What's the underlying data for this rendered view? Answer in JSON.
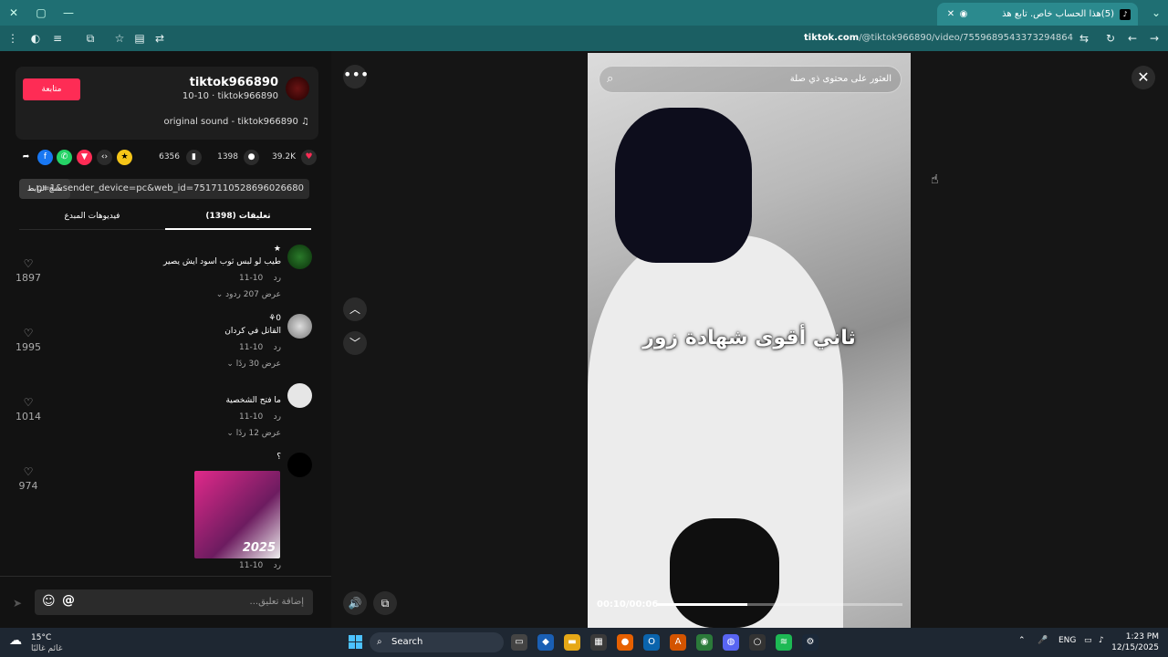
{
  "browser": {
    "tab_title": "(5)هذا الحساب خاص. تابع هذ",
    "tab_favicon": "tiktok-icon",
    "url_host": "tiktok.com",
    "url_path": "/@tiktok966890/video/7559689543373294864"
  },
  "author": {
    "username": "tiktok966890",
    "subline": "10-10 · tiktok966890",
    "follow_label": "متابعة",
    "sound": "original sound - tiktok966890"
  },
  "actions": {
    "likes": "39.2K",
    "comments": "1398",
    "saves": "6356"
  },
  "link": {
    "copy_label": "نسخ الرابط",
    "text": "...p=1&sender_device=pc&web_id=7517110528696026680"
  },
  "tabs": {
    "comments_label": "(1398) تعليقات",
    "creator_videos_label": "فيديوهات المبدع"
  },
  "comments": [
    {
      "name": "★",
      "text": "طيب لو لبس ثوب اسود ايش يصير",
      "date": "10-11",
      "reply": "رد",
      "view_replies": "عرض 207 ردود",
      "likes": "1897"
    },
    {
      "name": "⚘0",
      "text": "القاتل في كردان",
      "date": "10-11",
      "reply": "رد",
      "view_replies": "عرض 30 ردًا",
      "likes": "1995"
    },
    {
      "name": "",
      "text": "ما فتح الشخصية",
      "date": "10-11",
      "reply": "رد",
      "view_replies": "عرض 12 ردًا",
      "likes": "1014"
    },
    {
      "name": "؟",
      "text": "",
      "date": "10-11",
      "reply": "رد",
      "view_replies": "",
      "likes": "974",
      "sticker_label": "2025"
    }
  ],
  "input": {
    "placeholder": "إضافة تعليق..."
  },
  "video": {
    "search_placeholder": "العثور على محتوى ذي صلة",
    "caption": "ثاني أقوى شهادة زور",
    "time": "00:10/00:06",
    "progress": 0.37
  },
  "taskbar": {
    "temp": "15°C",
    "condition": "غائم غالبًا",
    "search_label": "Search",
    "lang": "ENG",
    "time": "1:23 PM",
    "date": "12/15/2025"
  },
  "colors": {
    "follow": "#fe2c55",
    "heart": "#fe2c55",
    "facebook": "#1877f2",
    "whatsapp": "#25d366",
    "tiktok_red": "#fe2c55",
    "coin": "#f5c518"
  }
}
